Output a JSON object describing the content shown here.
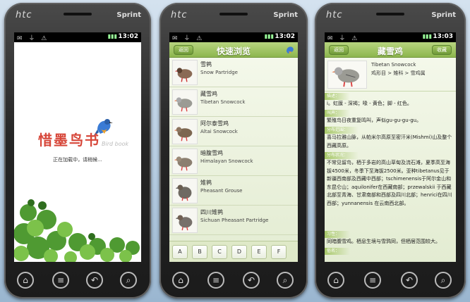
{
  "phones": {
    "brand": "htc",
    "carrier": "Sprint",
    "status_icons": "✉ ⏚ ⚠"
  },
  "splash": {
    "time": "13:02",
    "title": "惜墨鸟书",
    "subtitle": "Bird book",
    "loading": "正在加载中，请稍候..."
  },
  "browse": {
    "time": "13:02",
    "back": "返回",
    "title": "快速浏览",
    "items": [
      {
        "cn": "雪鹑",
        "en": "Snow Partridge"
      },
      {
        "cn": "藏雪鸡",
        "en": "Tibetan Snowcock"
      },
      {
        "cn": "阿尔泰雪鸡",
        "en": "Altai Snowcock"
      },
      {
        "cn": "暗腹雪鸡",
        "en": "Himalayan Snowcock"
      },
      {
        "cn": "雉鹑",
        "en": "Pheasant Grouse"
      },
      {
        "cn": "四川雉鹑",
        "en": "Sichuan Pheasant Partridge"
      }
    ],
    "alphabet": [
      "A",
      "B",
      "C",
      "D",
      "E",
      "F"
    ]
  },
  "detail": {
    "time": "13:03",
    "back": "返回",
    "title": "藏雪鸡",
    "fav": "收藏",
    "name_en": "Tibetan Snowcock",
    "classification": "鸡形目 > 雉科 > 雪鸡属",
    "sections": [
      {
        "head": "描述：",
        "body": "i。虹膜 - 深褐；喙 - 黄色；脚 - 红色。"
      },
      {
        "head": "叫声：",
        "body": "繁殖鸟日夜重复鸣叫，声似gu-gu-gu-gu。"
      },
      {
        "head": "分布范围：",
        "body": "喜马拉雅山脉，从帕米尔高原至密汗米(Mishmi)山及整个西藏高原。"
      },
      {
        "head": "分布状况：",
        "body": "不常见留鸟，栖于多岩的高山草甸及流石滩，夏季高至海拔4500米，冬季下至海拔2500米。亚种tibetanus见于新疆西南部及西藏中西部；tschimenensis于阿尔金山和东昆仑山；aquilonifer在西藏南部；przewalskii 于西藏北部至青海、甘肃南部和西部及四川北部；henrici在四川西部；yunnanensis 在云南西北部。"
      },
      {
        "head": "习性：",
        "body": "同暗腹雪鸡。栖息生境与雪鹑同，但栖居范围较大。"
      },
      {
        "head": "俗名：",
        "body": ""
      }
    ]
  }
}
